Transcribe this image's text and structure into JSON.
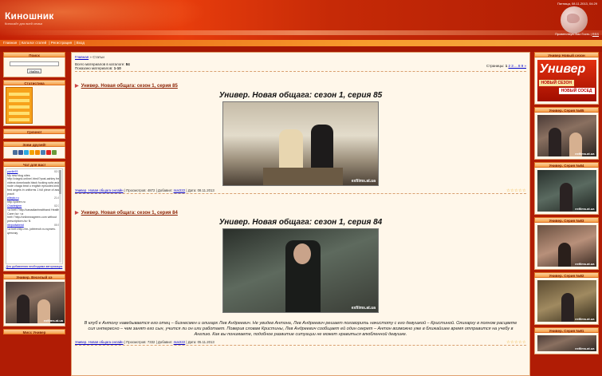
{
  "header": {
    "logo": "Киношник",
    "logo_sub": "Киносайт для всей семьи",
    "date": "Пятница, 08.11.2013, 04:29",
    "welcome_prefix": "Приветствую Вас",
    "welcome_user": "Гость",
    "rss": "RSS"
  },
  "nav": {
    "items": [
      "Главная",
      "Каталог статей",
      "Регистрация",
      "Вход"
    ]
  },
  "left": {
    "search_title": "Поиск",
    "search_button": "Найти",
    "stats_title": "Статистика",
    "urgent_title": "Срочно!",
    "friends_title": "Зови друзей!",
    "chat_title": "Чат для вас!",
    "chat": [
      {
        "name": "pavlin93",
        "time": "02:39",
        "text": "My new blog sites http://viagric.online/.html/?post-ashley free videos downloads black fucking sofa asian nude chaga beat u english episodes kinky, fred angels in uniforms 1 full piece of ass practi"
      },
      {
        "name": "pileplo.ru",
        "time": "21:03",
        "text": "http://pileen.ru"
      },
      {
        "name": "Charlesjem",
        "time": "02:30",
        "text": "<a href=\"http://canadianhealthand Health Care</a> <a href=\"http://onlinewagreen.com without prescription</a> N"
      },
      {
        "name": "ntvpodwiwnd",
        "time": "00:58",
        "text": "<a href=http://xn- jobtrench.ru>купить цепочку"
      }
    ],
    "chat_footer": "Для добавления необходима авторизация",
    "fun_title": "Универ. Веселый хэ",
    "fun_wm": "exfilms.at.ua",
    "miss_title": "Мисс Универ"
  },
  "right": {
    "new_title": "Универ Новый сезон",
    "poster_big": "Универ",
    "poster_b1": "НОВЫЙ СЕЗОН",
    "poster_b2": "НОВЫЙ СОСЕД",
    "series": [
      {
        "title": "Универ. Серия №85",
        "wm": "exfilms.at.ua"
      },
      {
        "title": "Универ. Серия №84",
        "wm": "exfilms.at.ua"
      },
      {
        "title": "Универ. Серия №83",
        "wm": "exfilms.at.ua"
      },
      {
        "title": "Универ. Серия №82",
        "wm": "exfilms.at.ua"
      },
      {
        "title": "Универ. Серия №81",
        "wm": "exfilms.at.ua"
      }
    ]
  },
  "main": {
    "breadcrumb_home": "Главная",
    "breadcrumb_sep": "»",
    "breadcrumb_current": "Статьи",
    "total_label": "Всего материалов в каталоге:",
    "total_value": "84",
    "shown_label": "Показано материалов:",
    "shown_value": "1-10",
    "pages_label": "Страницы:",
    "pages_current": "1",
    "pages_links": "2 3 ... 8 9 »",
    "entries": [
      {
        "title": "Универ. Новая общага: сезон 1, серия 85",
        "headline": "Универ. Новая общага: сезон 1, серия 85",
        "wm": "exfilms.at.ua",
        "desc": "",
        "category": "Универ. Новая общага онлайн",
        "views_label": "Просмотров:",
        "views": "4872",
        "added_label": "Добавил:",
        "author": "mar222",
        "date_label": "Дата:",
        "date": "08.11.2013",
        "stars": "☆☆☆☆☆"
      },
      {
        "title": "Универ. Новая общага: сезон 1, серия 84",
        "headline": "Универ. Новая общага: сезон 1, серия 84",
        "wm": "exfilms.at.ua",
        "desc": "В клуб к Антону наведывается его отец – бизнесмен и олигарх Лев Андреевич. Не увидев Антона, Лев Андреевич решает поговорить начистоту с его девушкой – Кристиной. Олигарху в полном расцвете сил интересно – чем занят его сын, учится ли он или работает. Поверив словам Кристины, Лев Андреевич сообщает ей один секрет – Антон возможно уже в ближайшее время отправится на учебу в Англию. Как вы понимаете, подобное развитие ситуации не может нравиться влюбленной девушке.",
        "category": "Универ. Новая общага онлайн",
        "views_label": "Просмотров:",
        "views": "7332",
        "added_label": "Добавил:",
        "author": "mar222",
        "date_label": "Дата:",
        "date": "05.11.2013",
        "stars": "☆☆☆☆☆"
      }
    ]
  }
}
